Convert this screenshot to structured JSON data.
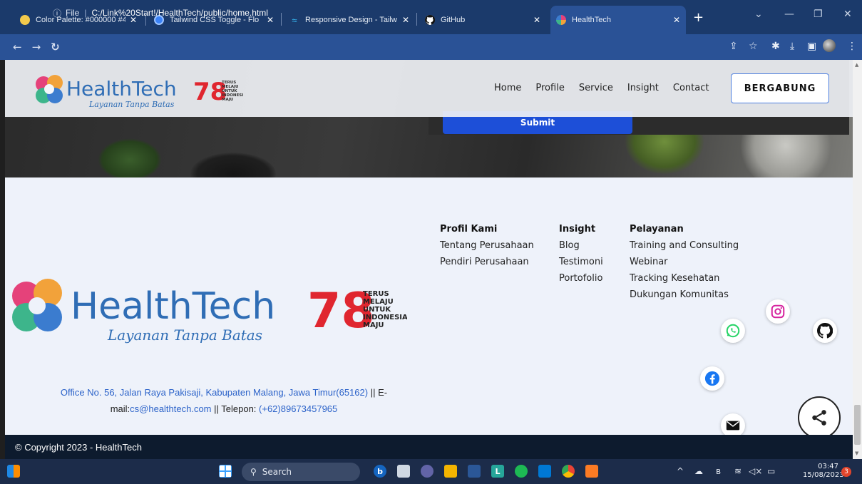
{
  "browser": {
    "tabs": [
      {
        "title": "Color Palette: #000000 #4",
        "close": "✕"
      },
      {
        "title": "Tailwind CSS Toggle - Flo",
        "close": "✕"
      },
      {
        "title": "Responsive Design - Tailw",
        "close": "✕"
      },
      {
        "title": "GitHub",
        "close": "✕"
      },
      {
        "title": "HealthTech",
        "close": "✕"
      }
    ],
    "new_tab": "+",
    "address": {
      "info": "ⓘ",
      "scheme": "File",
      "path": "C:/Link%20Start!/HealthTech/public/home.html"
    }
  },
  "navbar": {
    "brand": "HealthTech",
    "tagline": "Layanan Tanpa Batas",
    "badge_number": "78",
    "badge_lines": [
      "TERUS",
      "MELAJU",
      "UNTUK",
      "INDONESIA",
      "MAJU"
    ],
    "links": [
      "Home",
      "Profile",
      "Service",
      "Insight",
      "Contact"
    ],
    "join_label": "BERGABUNG"
  },
  "hero": {
    "submit_label": "Submit"
  },
  "footer": {
    "columns": [
      {
        "heading": "Profil Kami",
        "items": [
          "Tentang Perusahaan",
          "Pendiri Perusahaan"
        ]
      },
      {
        "heading": "Insight",
        "items": [
          "Blog",
          "Testimoni",
          "Portofolio"
        ]
      },
      {
        "heading": "Pelayanan",
        "items": [
          "Training and Consulting",
          "Webinar",
          "Tracking Kesehatan",
          "Dukungan Komunitas"
        ]
      }
    ],
    "address": {
      "office": "Office No. 56, Jalan Raya Pakisaji, Kabupaten Malang, Jawa Timur(65162)",
      "sep1": " || E-",
      "mail_label": "mail:",
      "email": "cs@healthtech.com",
      "sep2": " || Telepon: ",
      "phone": "(+62)89673457965"
    },
    "copyright": "© Copyright 2023 - HealthTech"
  },
  "taskbar": {
    "search": "Search",
    "time": "03:47",
    "date": "15/08/2023",
    "notifications": "3"
  },
  "colors": {
    "brand_blue": "#2f6db5",
    "footer_bg": "#eef2fa",
    "copyright_bg": "#0d1b2e",
    "submit_blue": "#1d4fd8"
  }
}
